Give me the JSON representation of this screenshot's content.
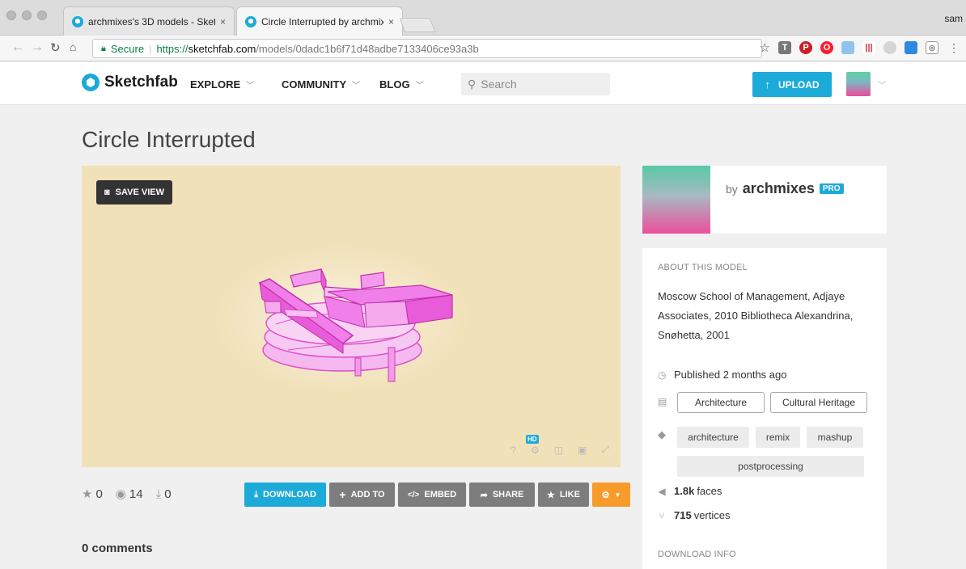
{
  "browser": {
    "tabs": [
      {
        "title": "archmixes's 3D models - Sketc",
        "active": false
      },
      {
        "title": "Circle Interrupted by archmixe",
        "active": true
      }
    ],
    "close_glyph": "×",
    "user": "sam",
    "secure_label": "Secure",
    "url_scheme": "https://",
    "url_host": "sketchfab.com",
    "url_path": "/models/0dadc1b6f71d48adbe7133406ce93a3b",
    "extensions": [
      "T",
      "P",
      "O",
      "",
      "|||",
      "",
      "",
      ""
    ]
  },
  "header": {
    "logo": "Sketchfab",
    "nav": [
      {
        "label": "EXPLORE"
      },
      {
        "label": "COMMUNITY"
      },
      {
        "label": "BLOG"
      }
    ],
    "search_placeholder": "Search",
    "upload_label": "UPLOAD"
  },
  "model": {
    "title": "Circle Interrupted",
    "save_view_label": "SAVE VIEW",
    "hd_badge": "HD",
    "stats": {
      "likes": "0",
      "views": "14",
      "downloads": "0"
    },
    "actions": {
      "download": "DOWNLOAD",
      "add_to": "ADD TO",
      "embed": "EMBED",
      "share": "SHARE",
      "like": "LIKE"
    },
    "comments_label": "0 comments"
  },
  "author": {
    "by": "by",
    "name": "archmixes",
    "badge": "PRO"
  },
  "about": {
    "section_title": "ABOUT THIS MODEL",
    "description": "Moscow School of Management, Adjaye Associates, 2010 Bibliotheca Alexandrina, Snøhetta, 2001",
    "published": "Published 2 months ago",
    "categories": [
      "Architecture",
      "Cultural Heritage"
    ],
    "tags": [
      "architecture",
      "remix",
      "mashup",
      "postprocessing"
    ],
    "faces_value": "1.8k",
    "faces_label": "faces",
    "vertices_value": "715",
    "vertices_label": "vertices",
    "download_info_title": "DOWNLOAD INFO"
  },
  "colors": {
    "accent": "#1caad9",
    "orange": "#f79b2b",
    "viewer_bg": "#f1e1b8",
    "model_pink": "#f27ef0"
  }
}
